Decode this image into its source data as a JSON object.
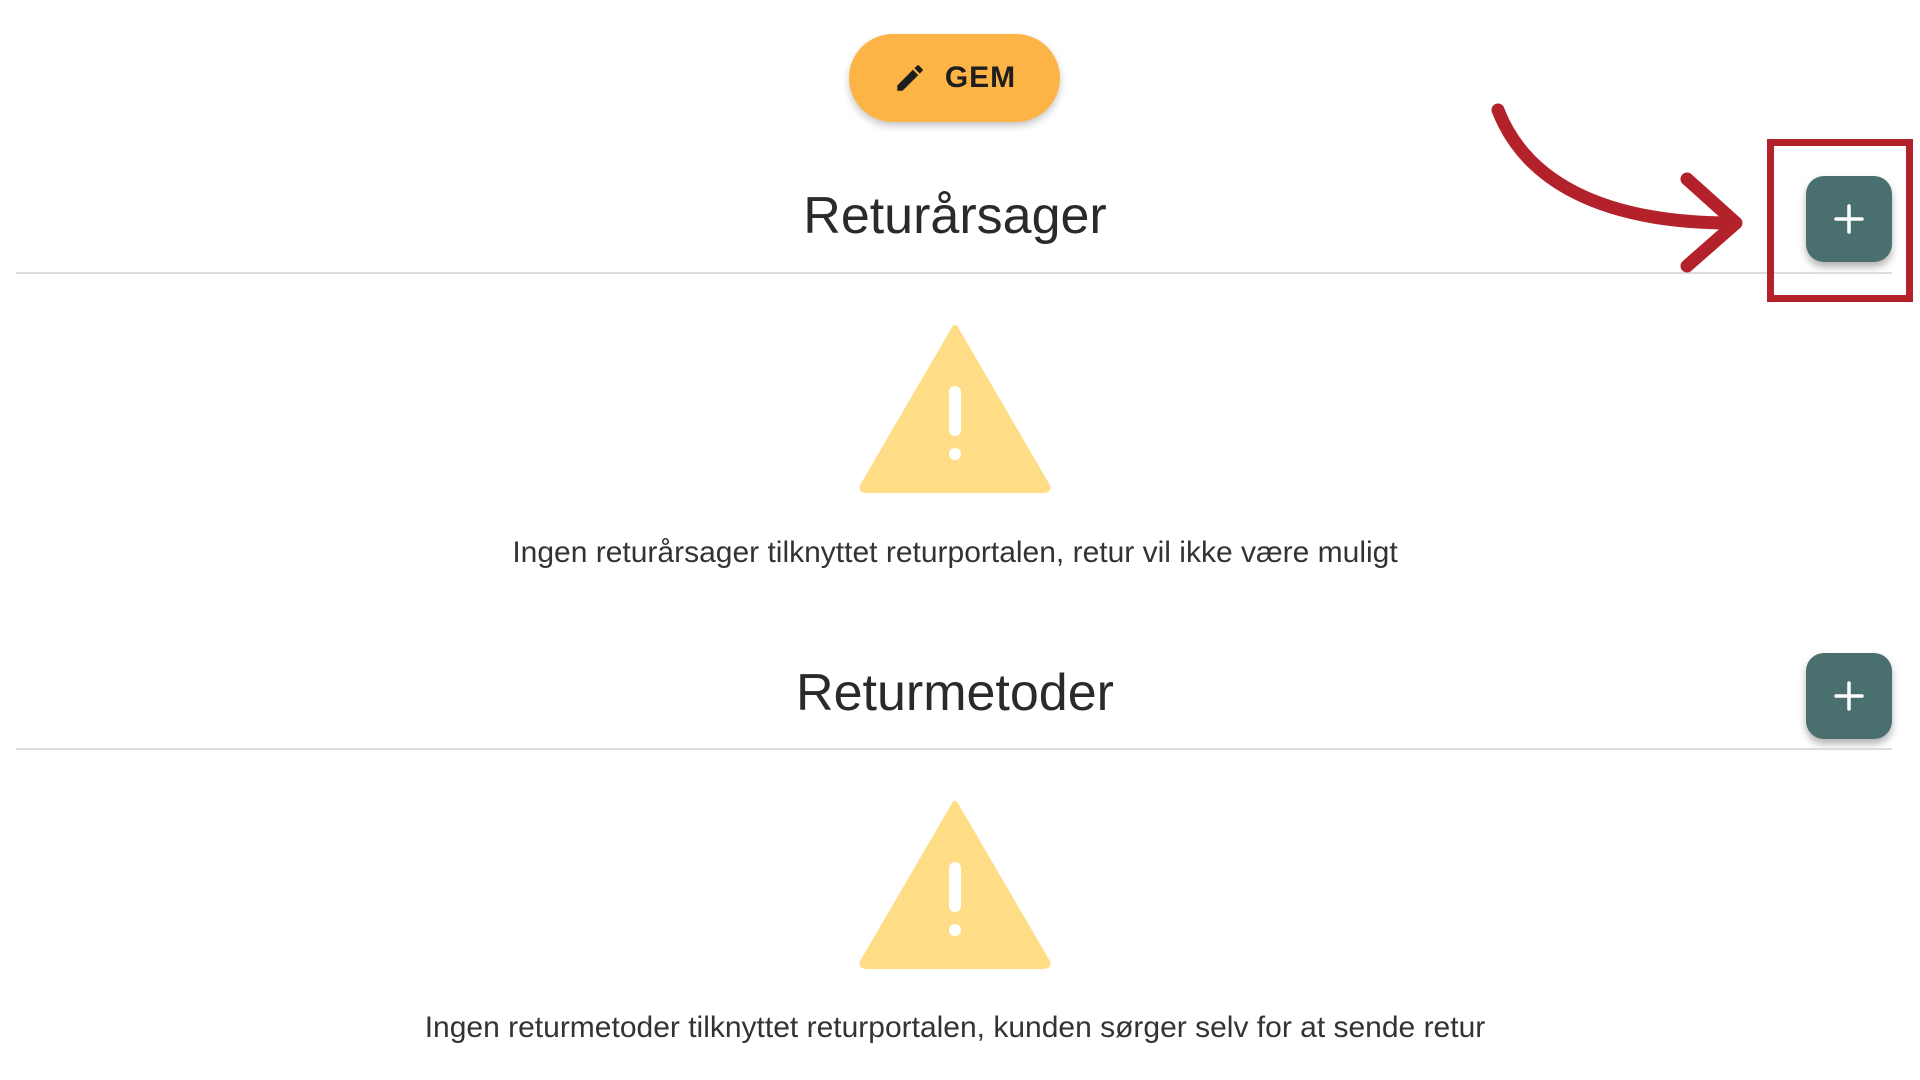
{
  "toolbar": {
    "save_label": "GEM",
    "save_icon": "pencil-icon"
  },
  "sections": [
    {
      "title": "Returårsager",
      "add_icon": "plus-icon",
      "empty_icon": "warning-icon",
      "empty_text": "Ingen returårsager tilknyttet returportalen, retur vil ikke være muligt"
    },
    {
      "title": "Returmetoder",
      "add_icon": "plus-icon",
      "empty_icon": "warning-icon",
      "empty_text": "Ingen returmetoder tilknyttet returportalen, kunden sørger selv for at sende retur"
    }
  ],
  "annotation": {
    "highlight_color": "#b3222a",
    "arrow_icon": "curved-arrow-icon"
  },
  "colors": {
    "save_button": "#fdb446",
    "add_button": "#49706f",
    "warning_icon": "#fedd86",
    "text": "#2a2a2a"
  }
}
